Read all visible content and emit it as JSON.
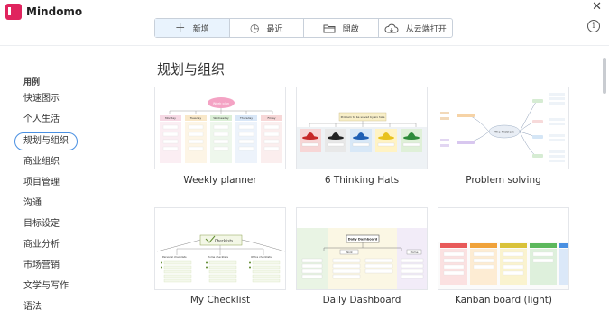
{
  "app": {
    "name": "Mindomo"
  },
  "toolbar": {
    "new_label": "新增",
    "recent_label": "最近",
    "open_label": "開啟",
    "cloud_label": "从云端打开"
  },
  "sidebar": {
    "heading": "用例",
    "items": [
      {
        "label": "快速图示"
      },
      {
        "label": "个人生活"
      },
      {
        "label": "规划与组织"
      },
      {
        "label": "商业组织"
      },
      {
        "label": "项目管理"
      },
      {
        "label": "沟通"
      },
      {
        "label": "目标设定"
      },
      {
        "label": "商业分析"
      },
      {
        "label": "市场营销"
      },
      {
        "label": "文学与写作"
      },
      {
        "label": "语法"
      }
    ]
  },
  "main": {
    "title": "规划与组织",
    "templates": [
      {
        "label": "Weekly planner"
      },
      {
        "label": "6 Thinking Hats"
      },
      {
        "label": "Problem solving"
      },
      {
        "label": "My Checklist"
      },
      {
        "label": "Daily Dashboard"
      },
      {
        "label": "Kanban board (light)"
      }
    ]
  },
  "thumb_text": {
    "weekly_title": "Week plan",
    "weekly_days": [
      "Monday",
      "Tuesday",
      "Wednesday",
      "Thursday",
      "Friday"
    ],
    "hats_title": "Problem to be solved by six hats",
    "problem_center": "The Problem",
    "checklist_title": "Checklists",
    "checklist_cols": [
      "Personal checklists",
      "Home checklists",
      "Office checklists"
    ],
    "dashboard_title": "Daily Dashboard",
    "dashboard_sub": [
      "Work",
      "Home"
    ]
  },
  "colors": {
    "accent": "#4a90e2",
    "brand": "#e0245e",
    "active_tab_bg": "#e9f3fd"
  }
}
